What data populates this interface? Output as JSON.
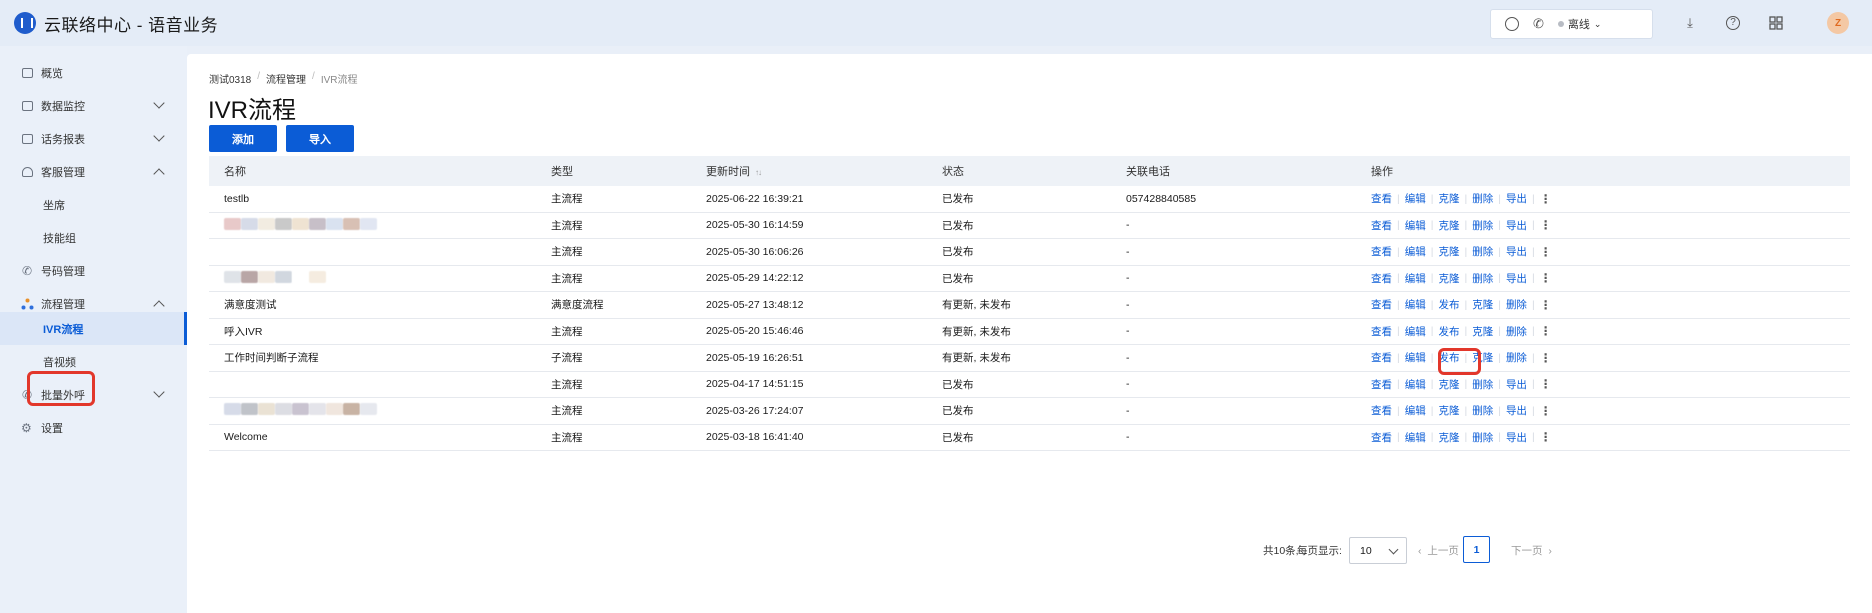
{
  "app": {
    "title": "云联络中心 - 语音业务"
  },
  "header": {
    "status": "离线",
    "icons": [
      "chat-icon",
      "phone-icon",
      "download-icon",
      "help-icon",
      "grid-icon"
    ],
    "avatar_initial": "Z"
  },
  "sidebar": {
    "items": [
      {
        "label": "概览",
        "icon": "dashboard-icon",
        "chevron": ""
      },
      {
        "label": "数据监控",
        "icon": "monitor-icon",
        "chevron": "down"
      },
      {
        "label": "话务报表",
        "icon": "report-icon",
        "chevron": "down"
      },
      {
        "label": "客服管理",
        "icon": "headset-icon",
        "chevron": "up"
      },
      {
        "label": "坐席",
        "icon": "",
        "chevron": ""
      },
      {
        "label": "技能组",
        "icon": "",
        "chevron": ""
      },
      {
        "label": "号码管理",
        "icon": "phone-icon",
        "chevron": ""
      },
      {
        "label": "流程管理",
        "icon": "flow-icon",
        "chevron": "up"
      },
      {
        "label": "IVR流程",
        "icon": "",
        "chevron": "",
        "active": true
      },
      {
        "label": "音视频",
        "icon": "",
        "chevron": ""
      },
      {
        "label": "批量外呼",
        "icon": "outbound-icon",
        "chevron": "down"
      },
      {
        "label": "设置",
        "icon": "settings-icon",
        "chevron": ""
      }
    ]
  },
  "breadcrumb": [
    "测试0318",
    "流程管理",
    "IVR流程"
  ],
  "page": {
    "title": "IVR流程"
  },
  "actions": {
    "add": "添加",
    "import": "导入"
  },
  "table": {
    "columns": [
      "名称",
      "类型",
      "更新时间",
      "状态",
      "关联电话",
      "操作"
    ],
    "rows": [
      {
        "name": "testlb",
        "type": "主流程",
        "time": "2025-06-22 16:39:21",
        "status": "已发布",
        "phone": "057428840585",
        "ops": [
          "查看",
          "编辑",
          "克隆",
          "删除",
          "导出"
        ]
      },
      {
        "name": "",
        "type": "主流程",
        "time": "2025-05-30 16:14:59",
        "status": "已发布",
        "phone": "-",
        "ops": [
          "查看",
          "编辑",
          "克隆",
          "删除",
          "导出"
        ]
      },
      {
        "name": "",
        "type": "主流程",
        "time": "2025-05-30 16:06:26",
        "status": "已发布",
        "phone": "-",
        "ops": [
          "查看",
          "编辑",
          "克隆",
          "删除",
          "导出"
        ]
      },
      {
        "name": "",
        "type": "主流程",
        "time": "2025-05-29 14:22:12",
        "status": "已发布",
        "phone": "-",
        "ops": [
          "查看",
          "编辑",
          "克隆",
          "删除",
          "导出"
        ]
      },
      {
        "name": "满意度测试",
        "type": "满意度流程",
        "time": "2025-05-27 13:48:12",
        "status": "有更新, 未发布",
        "phone": "-",
        "ops": [
          "查看",
          "编辑",
          "发布",
          "克隆",
          "删除"
        ]
      },
      {
        "name": "呼入IVR",
        "type": "主流程",
        "time": "2025-05-20 15:46:46",
        "status": "有更新, 未发布",
        "phone": "-",
        "ops": [
          "查看",
          "编辑",
          "发布",
          "克隆",
          "删除"
        ]
      },
      {
        "name": "工作时间判断子流程",
        "type": "子流程",
        "time": "2025-05-19 16:26:51",
        "status": "有更新, 未发布",
        "phone": "-",
        "ops": [
          "查看",
          "编辑",
          "发布",
          "克隆",
          "删除"
        ]
      },
      {
        "name": "",
        "type": "主流程",
        "time": "2025-04-17 14:51:15",
        "status": "已发布",
        "phone": "-",
        "ops": [
          "查看",
          "编辑",
          "克隆",
          "删除",
          "导出"
        ]
      },
      {
        "name": "",
        "type": "主流程",
        "time": "2025-03-26 17:24:07",
        "status": "已发布",
        "phone": "-",
        "ops": [
          "查看",
          "编辑",
          "克隆",
          "删除",
          "导出"
        ]
      },
      {
        "name": "Welcome",
        "type": "主流程",
        "time": "2025-03-18 16:41:40",
        "status": "已发布",
        "phone": "-",
        "ops": [
          "查看",
          "编辑",
          "克隆",
          "删除",
          "导出"
        ]
      }
    ]
  },
  "pagination": {
    "total_text": "共10条,",
    "per_page_label": "每页显示:",
    "per_page": "10",
    "prev": "上一页",
    "current": "1",
    "next": "下一页"
  },
  "colors": {
    "primary": "#0b5cd6",
    "highlight": "#e2372b",
    "sidebar_bg": "#eaf0f9"
  }
}
